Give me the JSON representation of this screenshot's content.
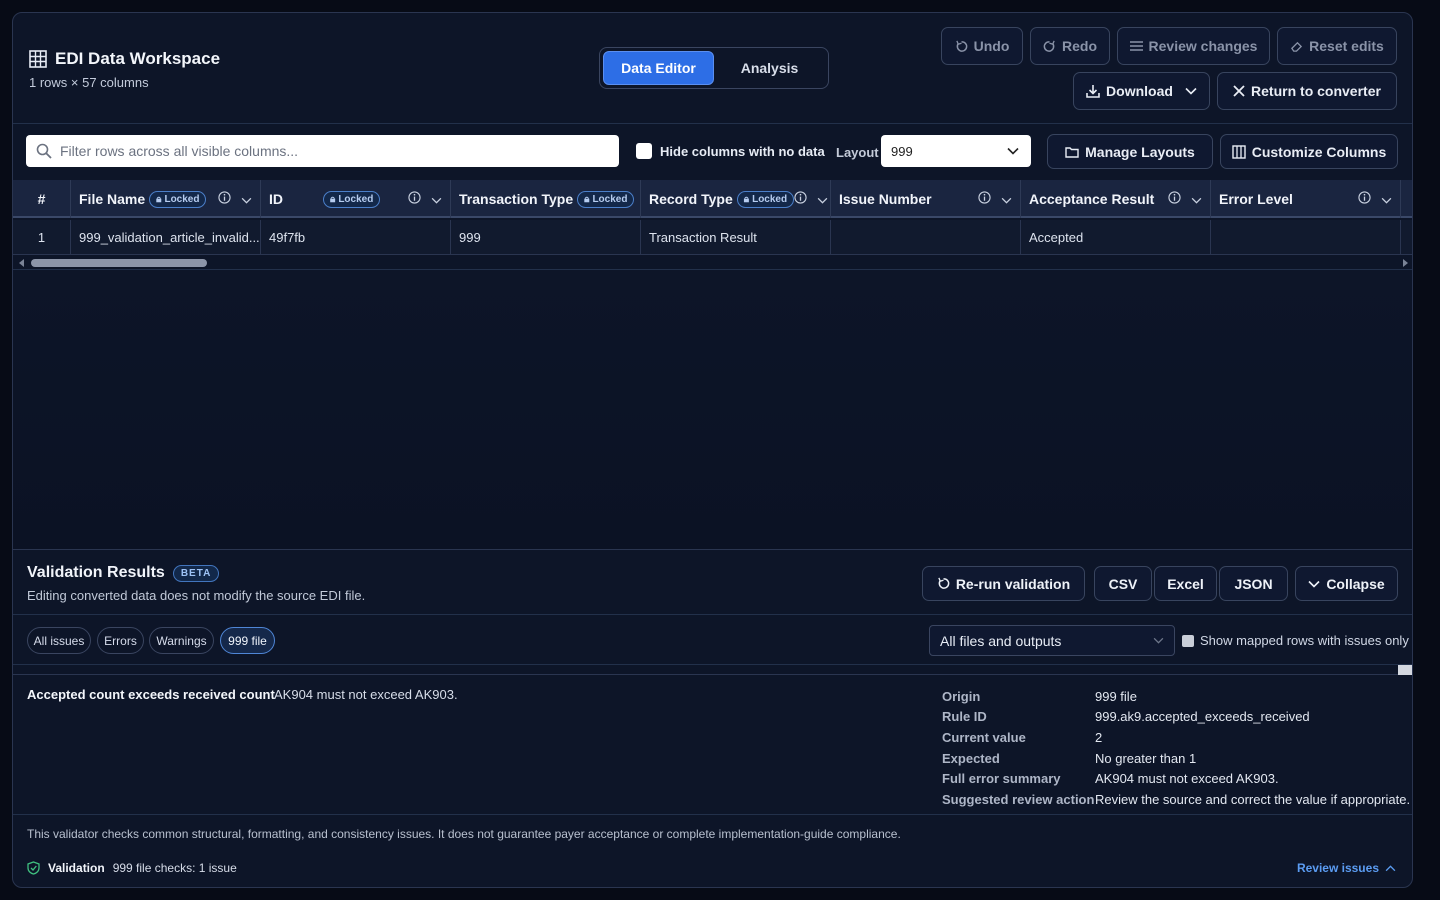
{
  "header": {
    "title": "EDI Data Workspace",
    "subtitle": "1 rows × 57 columns",
    "mode_tabs": [
      {
        "label": "Data Editor",
        "active": true
      },
      {
        "label": "Analysis",
        "active": false
      }
    ],
    "actions": {
      "undo": "Undo",
      "redo": "Redo",
      "review_changes": "Review changes",
      "reset_edits": "Reset edits",
      "download": "Download",
      "return_to_converter": "Return to converter"
    }
  },
  "toolbar": {
    "filter_placeholder": "Filter rows across all visible columns...",
    "hide_empty_label": "Hide columns with no data",
    "layout_label": "Layout",
    "layout_value": "999",
    "manage_layouts": "Manage Layouts",
    "customize_columns": "Customize Columns"
  },
  "table": {
    "index_header": "#",
    "locked_label": "Locked",
    "columns": [
      {
        "label": "File Name",
        "locked": true
      },
      {
        "label": "ID",
        "locked": true
      },
      {
        "label": "Transaction Type",
        "locked": true
      },
      {
        "label": "Record Type",
        "locked": true
      },
      {
        "label": "Issue Number",
        "locked": false
      },
      {
        "label": "Acceptance Result",
        "locked": false
      },
      {
        "label": "Error Level",
        "locked": false
      }
    ],
    "rows": [
      {
        "index": "1",
        "cells": [
          "999_validation_article_invalid...",
          "49f7fb",
          "999",
          "Transaction Result",
          "",
          "Accepted",
          ""
        ]
      }
    ]
  },
  "validation": {
    "title": "Validation Results",
    "badge": "BETA",
    "subtitle": "Editing converted data does not modify the source EDI file.",
    "buttons": {
      "rerun": "Re-run validation",
      "csv": "CSV",
      "excel": "Excel",
      "json": "JSON",
      "collapse": "Collapse"
    },
    "filters": [
      "All issues",
      "Errors",
      "Warnings",
      "999 file"
    ],
    "active_filter": "999 file",
    "scope_select": "All files and outputs",
    "mapped_only_label": "Show mapped rows with issues only",
    "issue": {
      "title": "Accepted count exceeds received count",
      "description": "AK904 must not exceed AK903.",
      "details": [
        {
          "key": "Origin",
          "value": "999 file"
        },
        {
          "key": "Rule ID",
          "value": "999.ak9.accepted_exceeds_received"
        },
        {
          "key": "Current value",
          "value": "2"
        },
        {
          "key": "Expected",
          "value": "No greater than 1"
        },
        {
          "key": "Full error summary",
          "value": "AK904 must not exceed AK903."
        },
        {
          "key": "Suggested review action",
          "value": "Review the source and correct the value if appropriate."
        }
      ]
    },
    "disclaimer": "This validator checks common structural, formatting, and consistency issues. It does not guarantee payer acceptance or complete implementation-guide compliance.",
    "footer": {
      "label": "Validation",
      "summary": "999 file checks: 1 issue",
      "review_link": "Review issues"
    }
  },
  "colors": {
    "accent": "#2d6ee6",
    "link": "#5b9cf2",
    "background": "#0d1528"
  }
}
